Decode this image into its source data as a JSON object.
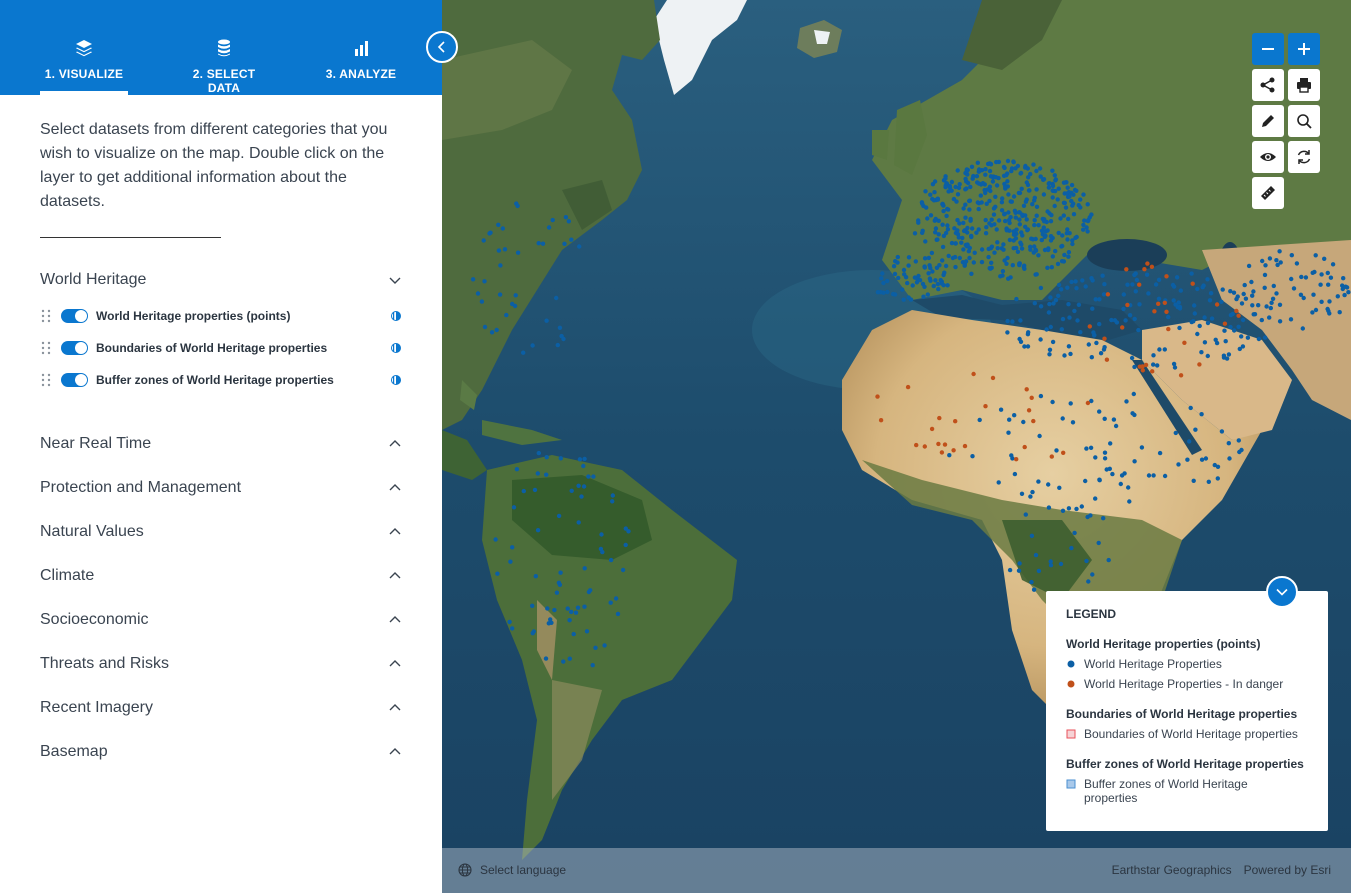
{
  "nav": {
    "tabs": [
      {
        "label": "1. VISUALIZE",
        "icon": "layers-icon",
        "active": true
      },
      {
        "label": "2. SELECT DATA",
        "icon": "database-icon",
        "active": false
      },
      {
        "label": "3. ANALYZE",
        "icon": "bar-chart-icon",
        "active": false
      }
    ]
  },
  "sidebar": {
    "intro": "Select datasets from different categories that you wish to visualize on the map. Double click on the layer to get additional information about the datasets.",
    "sections": [
      {
        "title": "World Heritage",
        "expanded": true,
        "layers": [
          {
            "label": "World Heritage properties (points)",
            "enabled": true
          },
          {
            "label": "Boundaries of World Heritage properties",
            "enabled": true
          },
          {
            "label": "Buffer zones of World Heritage properties",
            "enabled": true
          }
        ]
      },
      {
        "title": "Near Real Time",
        "expanded": false
      },
      {
        "title": "Protection and Management",
        "expanded": false
      },
      {
        "title": "Natural Values",
        "expanded": false
      },
      {
        "title": "Climate",
        "expanded": false
      },
      {
        "title": "Socioeconomic",
        "expanded": false
      },
      {
        "title": "Threats and Risks",
        "expanded": false
      },
      {
        "title": "Recent Imagery",
        "expanded": false
      },
      {
        "title": "Basemap",
        "expanded": false
      }
    ]
  },
  "map": {
    "controls": [
      "zoom-out-icon",
      "zoom-in-icon",
      "share-icon",
      "print-icon",
      "pencil-icon",
      "search-icon",
      "eye-icon",
      "refresh-icon",
      "ruler-icon"
    ],
    "legend": {
      "title": "LEGEND",
      "groups": [
        {
          "title": "World Heritage properties (points)",
          "items": [
            {
              "label": "World Heritage Properties",
              "symbol": "dot",
              "color": "#0b5fa5"
            },
            {
              "label": "World Heritage Properties - In danger",
              "symbol": "dot",
              "color": "#c0501a"
            }
          ]
        },
        {
          "title": "Boundaries of World Heritage properties",
          "items": [
            {
              "label": "Boundaries of World Heritage properties",
              "symbol": "square",
              "color": "#e8505b"
            }
          ]
        },
        {
          "title": "Buffer zones of World Heritage properties",
          "items": [
            {
              "label": "Buffer zones of World Heritage properties",
              "symbol": "square",
              "color": "#4a8fd0"
            }
          ]
        }
      ]
    },
    "language_label": "Select language",
    "attribution": [
      "Earthstar Geographics",
      "Powered by Esri"
    ]
  },
  "colors": {
    "accent": "#0a77cf",
    "text": "#3a4450",
    "ocean": "#1f4f6e"
  }
}
